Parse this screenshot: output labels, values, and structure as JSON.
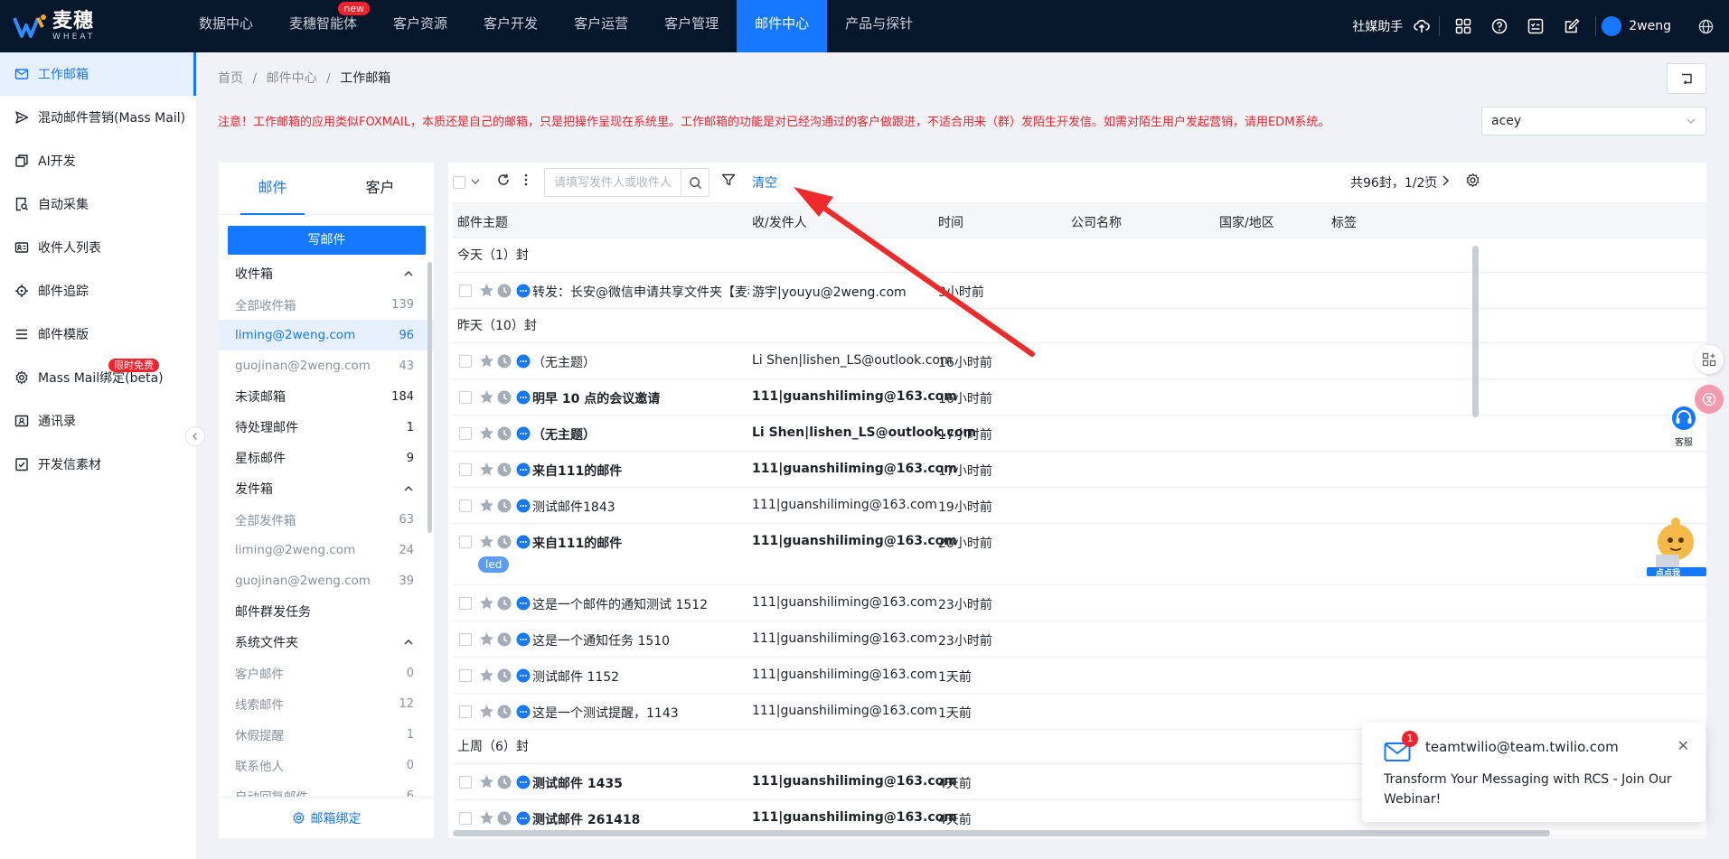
{
  "brand": {
    "name_cn": "麦穗",
    "name_en": "WHEAT"
  },
  "nav": [
    {
      "label": "数据中心"
    },
    {
      "label": "麦穗智能体",
      "badge": "new"
    },
    {
      "label": "客户资源"
    },
    {
      "label": "客户开发"
    },
    {
      "label": "客户运营"
    },
    {
      "label": "客户管理"
    },
    {
      "label": "邮件中心",
      "active": true
    },
    {
      "label": "产品与探针"
    }
  ],
  "topright": {
    "social": "社媒助手",
    "user": "2weng"
  },
  "sidebar": [
    {
      "label": "工作邮箱",
      "icon": "mail-icon",
      "active": true
    },
    {
      "label": "混动邮件营销(Mass Mail)",
      "icon": "send-icon"
    },
    {
      "label": "AI开发",
      "icon": "copy-icon"
    },
    {
      "label": "自动采集",
      "icon": "search-doc-icon"
    },
    {
      "label": "收件人列表",
      "icon": "contact-card-icon"
    },
    {
      "label": "邮件追踪",
      "icon": "target-icon"
    },
    {
      "label": "邮件模版",
      "icon": "list-icon"
    },
    {
      "label": "Mass Mail绑定(beta)",
      "icon": "gear-icon",
      "badge": "限时免费"
    },
    {
      "label": "通讯录",
      "icon": "address-book-icon"
    },
    {
      "label": "开发信素材",
      "icon": "checklist-icon"
    }
  ],
  "breadcrumb": {
    "home": "首页",
    "section": "邮件中心",
    "current": "工作邮箱"
  },
  "notice": "注意！工作邮箱的应用类似FOXMAIL，本质还是自己的邮箱，只是把操作呈现在系统里。工作邮箱的功能是对已经沟通过的客户做跟进，不适合用来（群）发陌生开发信。如需对陌生用户发起营销，请用EDM系统。",
  "account_select": "acey",
  "left_tabs": {
    "mail": "邮件",
    "customer": "客户"
  },
  "compose": "写邮件",
  "folders": [
    {
      "type": "group",
      "label": "收件箱"
    },
    {
      "type": "sub",
      "label": "全部收件箱",
      "count": "139"
    },
    {
      "type": "sub",
      "label": "liming@2weng.com",
      "count": "96",
      "active": true
    },
    {
      "type": "sub",
      "label": "guojinan@2weng.com",
      "count": "43"
    },
    {
      "type": "item",
      "label": "未读邮箱",
      "count": "184"
    },
    {
      "type": "item",
      "label": "待处理邮件",
      "count": "1"
    },
    {
      "type": "item",
      "label": "星标邮件",
      "count": "9"
    },
    {
      "type": "group",
      "label": "发件箱"
    },
    {
      "type": "sub",
      "label": "全部发件箱",
      "count": "63"
    },
    {
      "type": "sub",
      "label": "liming@2weng.com",
      "count": "24"
    },
    {
      "type": "sub",
      "label": "guojinan@2weng.com",
      "count": "39"
    },
    {
      "type": "item",
      "label": "邮件群发任务",
      "count": ""
    },
    {
      "type": "group",
      "label": "系统文件夹"
    },
    {
      "type": "sub",
      "label": "客户邮件",
      "count": "0"
    },
    {
      "type": "sub",
      "label": "线索邮件",
      "count": "12"
    },
    {
      "type": "sub",
      "label": "休假提醒",
      "count": "1"
    },
    {
      "type": "sub",
      "label": "联系他人",
      "count": "0"
    },
    {
      "type": "sub",
      "label": "自动回复邮件",
      "count": "6"
    }
  ],
  "bind_label": "邮箱绑定",
  "toolbar": {
    "search_placeholder": "请填写发件人或收件人",
    "clear": "清空",
    "page_info": "共96封，1/2页"
  },
  "columns": [
    "邮件主题",
    "收/发件人",
    "时间",
    "公司名称",
    "国家/地区",
    "标签"
  ],
  "email_groups": [
    {
      "label": "今天（1）封",
      "rows": [
        {
          "subject": "转发：长安@微信申请共享文件夹【麦穗...",
          "from": "游宇|youyu@2weng.com",
          "time": "3小时前",
          "bold": false
        }
      ]
    },
    {
      "label": "昨天（10）封",
      "rows": [
        {
          "subject": "（无主题）",
          "from": "Li Shen|lishen_LS@outlook.com",
          "time": "16小时前",
          "bold": false
        },
        {
          "subject": "明早 10 点的会议邀请",
          "from": "111|guanshiliming@163.com",
          "time": "16小时前",
          "bold": true
        },
        {
          "subject": "（无主题）",
          "from": "Li Shen|lishen_LS@outlook.com",
          "time": "17小时前",
          "bold": true
        },
        {
          "subject": "来自111的邮件",
          "from": "111|guanshiliming@163.com",
          "time": "17小时前",
          "bold": true
        },
        {
          "subject": "测试邮件1843",
          "from": "111|guanshiliming@163.com",
          "time": "19小时前",
          "bold": false
        },
        {
          "subject": "来自111的邮件",
          "from": "111|guanshiliming@163.com",
          "time": "20小时前",
          "bold": true,
          "tag": "led"
        },
        {
          "subject": "这是一个邮件的通知测试 1512",
          "from": "111|guanshiliming@163.com",
          "time": "23小时前",
          "bold": false
        },
        {
          "subject": "这是一个通知任务 1510",
          "from": "111|guanshiliming@163.com",
          "time": "23小时前",
          "bold": false
        },
        {
          "subject": "测试邮件 1152",
          "from": "111|guanshiliming@163.com",
          "time": "1天前",
          "bold": false
        },
        {
          "subject": "这是一个测试提醒，1143",
          "from": "111|guanshiliming@163.com",
          "time": "1天前",
          "bold": false
        }
      ]
    },
    {
      "label": "上周（6）封",
      "rows": [
        {
          "subject": "测试邮件 1435",
          "from": "111|guanshiliming@163.com",
          "time": "4天前",
          "bold": true
        },
        {
          "subject": "测试邮件 261418",
          "from": "111|guanshiliming@163.com",
          "time": "4天前",
          "bold": true
        }
      ]
    }
  ],
  "toast": {
    "badge": "1",
    "from": "teamtwilio@team.twilio.com",
    "message": "Transform Your Messaging with RCS - Join Our Webinar!"
  },
  "kefu": "客服",
  "mascot_label": "点点我",
  "colors": {
    "primary": "#1677ff",
    "topbar": "#07172b",
    "danger": "#f5222d",
    "arrow": "#ee2b2b"
  }
}
